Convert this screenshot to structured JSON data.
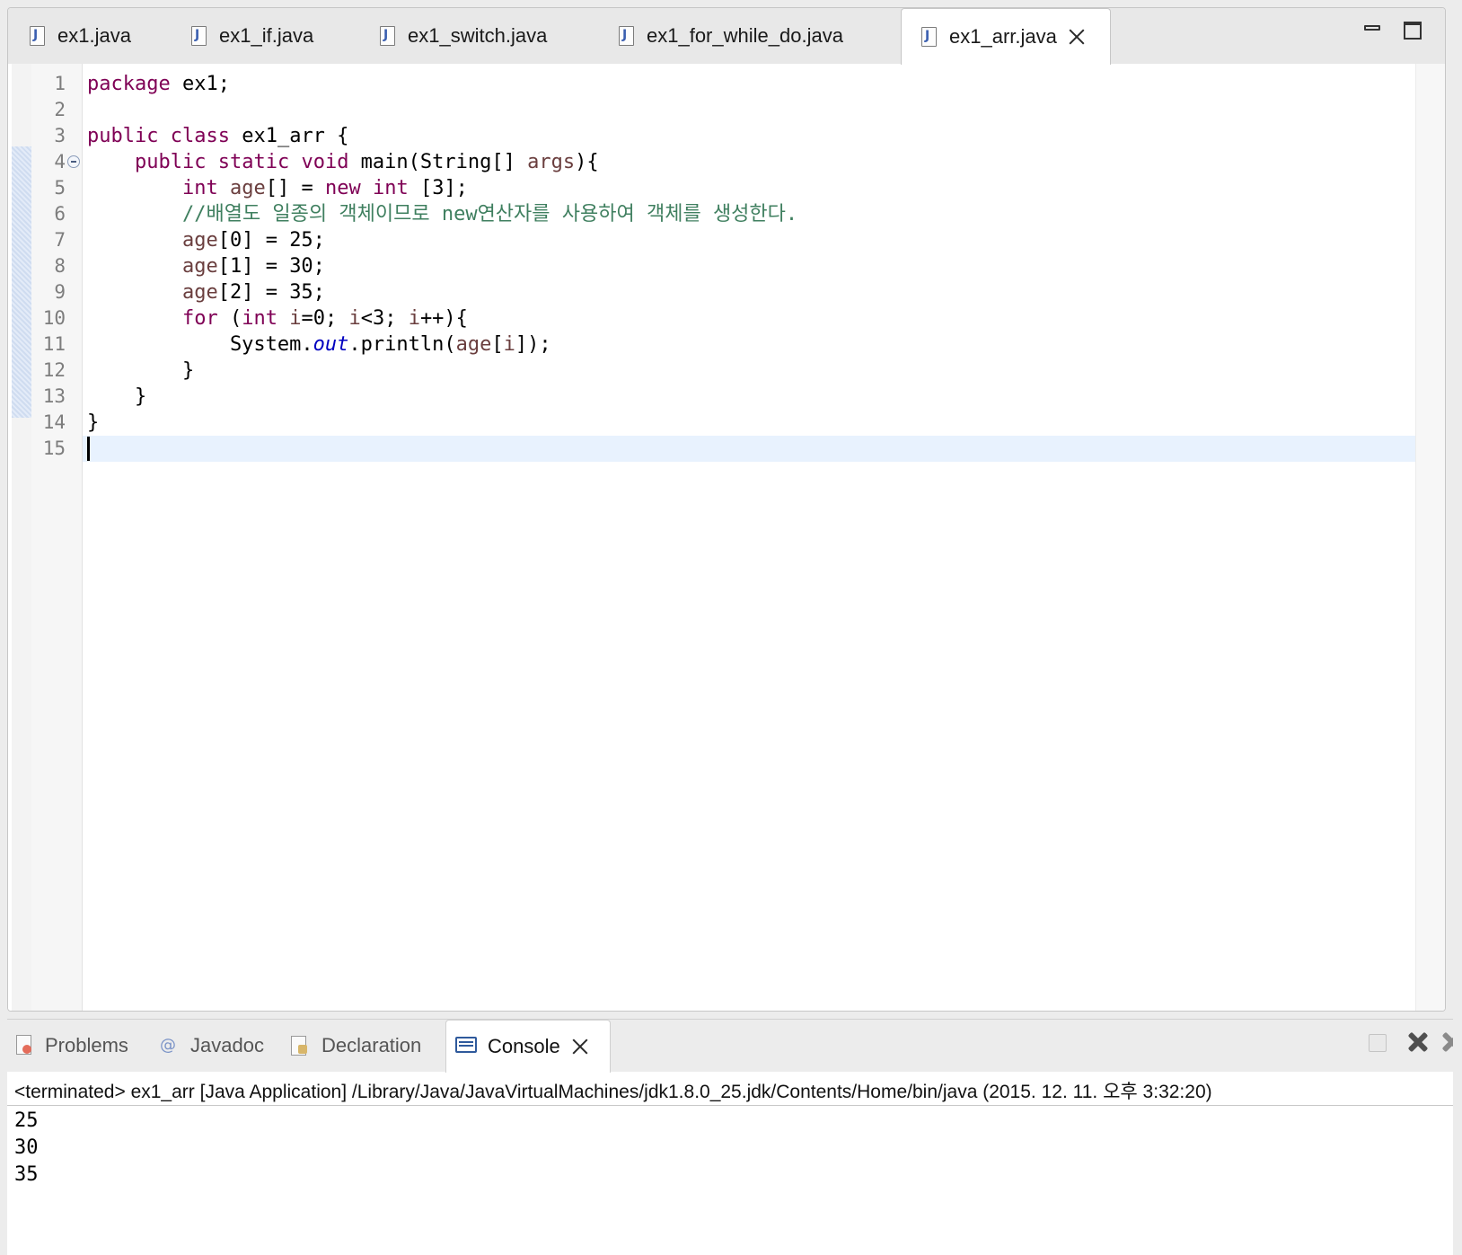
{
  "editor": {
    "tabs": [
      {
        "label": "ex1.java",
        "active": false
      },
      {
        "label": "ex1_if.java",
        "active": false
      },
      {
        "label": "ex1_switch.java",
        "active": false
      },
      {
        "label": "ex1_for_while_do.java",
        "active": false
      },
      {
        "label": "ex1_arr.java",
        "active": true
      }
    ],
    "line_numbers": [
      "1",
      "2",
      "3",
      "4",
      "5",
      "6",
      "7",
      "8",
      "9",
      "10",
      "11",
      "12",
      "13",
      "14",
      "15"
    ],
    "code_lines": [
      "package ex1;",
      "",
      "public class ex1_arr {",
      "    public static void main(String[] args){",
      "        int age[] = new int [3];",
      "        //배열도 일종의 객체이므로 new연산자를 사용하여 객체를 생성한다.",
      "        age[0] = 25;",
      "        age[1] = 30;",
      "        age[2] = 35;",
      "        for (int i=0; i<3; i++){",
      "            System.out.println(age[i]);",
      "        }",
      "    }",
      "}",
      ""
    ],
    "current_line": 15,
    "colors": {
      "keyword": "#7f0055",
      "local_variable": "#6a3e3e",
      "static_field": "#0000c0",
      "comment": "#3f7f5f",
      "current_line_highlight": "#e8f2fe"
    }
  },
  "bottom_panel": {
    "tabs": [
      {
        "label": "Problems",
        "icon": "problems-icon",
        "active": false
      },
      {
        "label": "Javadoc",
        "icon": "at-sign-icon",
        "active": false
      },
      {
        "label": "Declaration",
        "icon": "declaration-icon",
        "active": false
      },
      {
        "label": "Console",
        "icon": "console-icon",
        "active": true
      }
    ],
    "console": {
      "header": "<terminated> ex1_arr [Java Application] /Library/Java/JavaVirtualMachines/jdk1.8.0_25.jdk/Contents/Home/bin/java (2015. 12. 11. 오후 3:32:20)",
      "output": [
        "25",
        "30",
        "35"
      ]
    }
  }
}
